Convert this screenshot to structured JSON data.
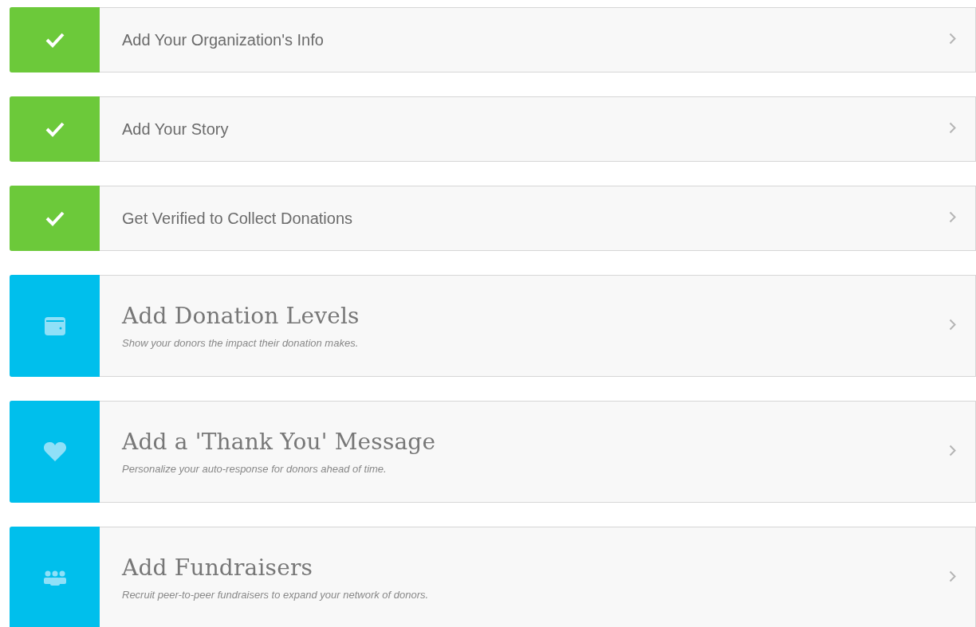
{
  "steps": [
    {
      "title": "Add Your Organization's Info",
      "completed": true
    },
    {
      "title": "Add Your Story",
      "completed": true
    },
    {
      "title": "Get Verified to Collect Donations",
      "completed": true
    },
    {
      "title": "Add Donation Levels",
      "subtitle": "Show your donors the impact their donation makes.",
      "completed": false
    },
    {
      "title": "Add a 'Thank You' Message",
      "subtitle": "Personalize your auto-response for donors ahead of time.",
      "completed": false
    },
    {
      "title": "Add Fundraisers",
      "subtitle": "Recruit peer-to-peer fundraisers to expand your network of donors.",
      "completed": false
    }
  ]
}
